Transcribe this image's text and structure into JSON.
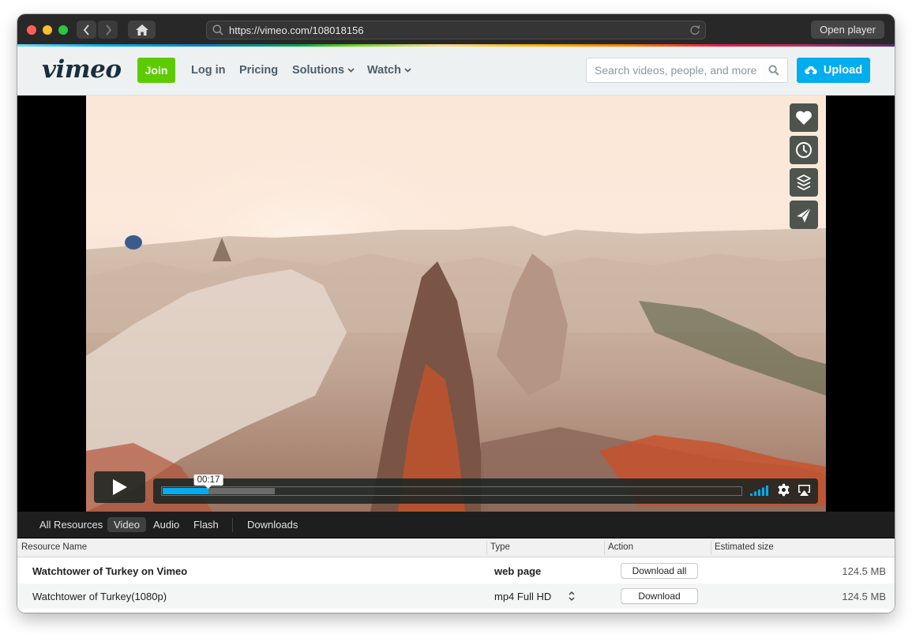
{
  "browser": {
    "url": "https://vimeo.com/108018156",
    "open_player_label": "Open player",
    "icons": [
      "back-icon",
      "forward-icon",
      "home-icon",
      "search-icon",
      "reload-icon"
    ]
  },
  "vimeo_header": {
    "logo": "vimeo",
    "join_label": "Join",
    "nav": [
      {
        "label": "Log in",
        "has_dropdown": false
      },
      {
        "label": "Pricing",
        "has_dropdown": false
      },
      {
        "label": "Solutions",
        "has_dropdown": true
      },
      {
        "label": "Watch",
        "has_dropdown": true
      }
    ],
    "search_placeholder": "Search videos, people, and more",
    "upload_label": "Upload",
    "colors": {
      "join": "#5ccc00",
      "upload": "#00adef",
      "nav_text": "#4d5e6b"
    }
  },
  "player": {
    "side_buttons": [
      "heart-icon",
      "clock-icon",
      "layers-icon",
      "send-icon"
    ],
    "current_time": "00:17",
    "played_fraction": 0.079,
    "buffered_fraction": 0.193,
    "volume_level_bars": 5,
    "accent_color": "#00adef"
  },
  "resource_panel": {
    "tabs": [
      {
        "label": "All Resources",
        "active": false
      },
      {
        "label": "Video",
        "active": true
      },
      {
        "label": "Audio",
        "active": false
      },
      {
        "label": "Flash",
        "active": false
      },
      {
        "label": "Downloads",
        "active": false
      }
    ],
    "columns": [
      "Resource Name",
      "Type",
      "Action",
      "Estimated size"
    ],
    "rows": [
      {
        "name": "Watchtower of Turkey on Vimeo",
        "type": "web page",
        "action": "Download all",
        "size": "124.5 MB"
      },
      {
        "name": "Watchtower of Turkey(1080p)",
        "type": "mp4 Full HD",
        "action": "Download",
        "size": "124.5 MB"
      }
    ]
  }
}
